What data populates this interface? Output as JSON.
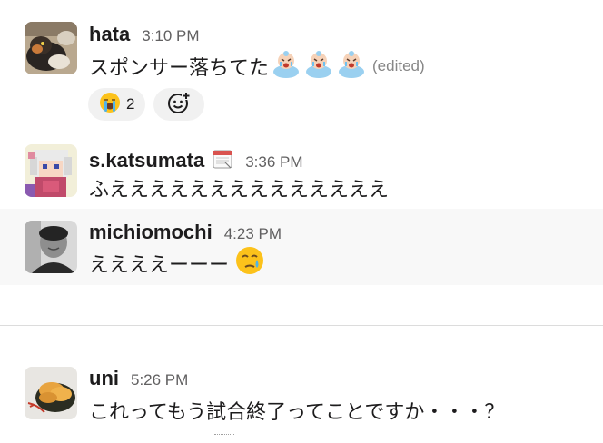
{
  "messages": [
    {
      "author": "hata",
      "time": "3:10 PM",
      "text": "スポンサー落ちてた",
      "edited_label": "(edited)",
      "trailing_emoji": [
        "crying-baby-emoji",
        "crying-baby-emoji",
        "crying-baby-emoji"
      ],
      "reactions": [
        {
          "emoji": "loudly-crying-face",
          "count": "2"
        }
      ],
      "add_reaction_icon": "add-reaction-icon"
    },
    {
      "author": "s.katsumata",
      "status_emoji": "calendar-emoji",
      "time": "3:36 PM",
      "text": "ふええええええええええええええ"
    },
    {
      "author": "michiomochi",
      "time": "4:23 PM",
      "text": "ええええーーー",
      "trailing_emoji": [
        "face-holding-back-tears-emoji"
      ]
    },
    {
      "author": "uni",
      "time": "5:26 PM",
      "text": "これってもう試合終了ってことですか・・・？"
    }
  ],
  "colors": {
    "text": "#1d1c1d",
    "timestamp": "#616061",
    "edited": "#868686",
    "hover_bg": "#f8f8f8",
    "reaction_bg": "#f1f1f1",
    "divider": "#dcdcdc"
  }
}
